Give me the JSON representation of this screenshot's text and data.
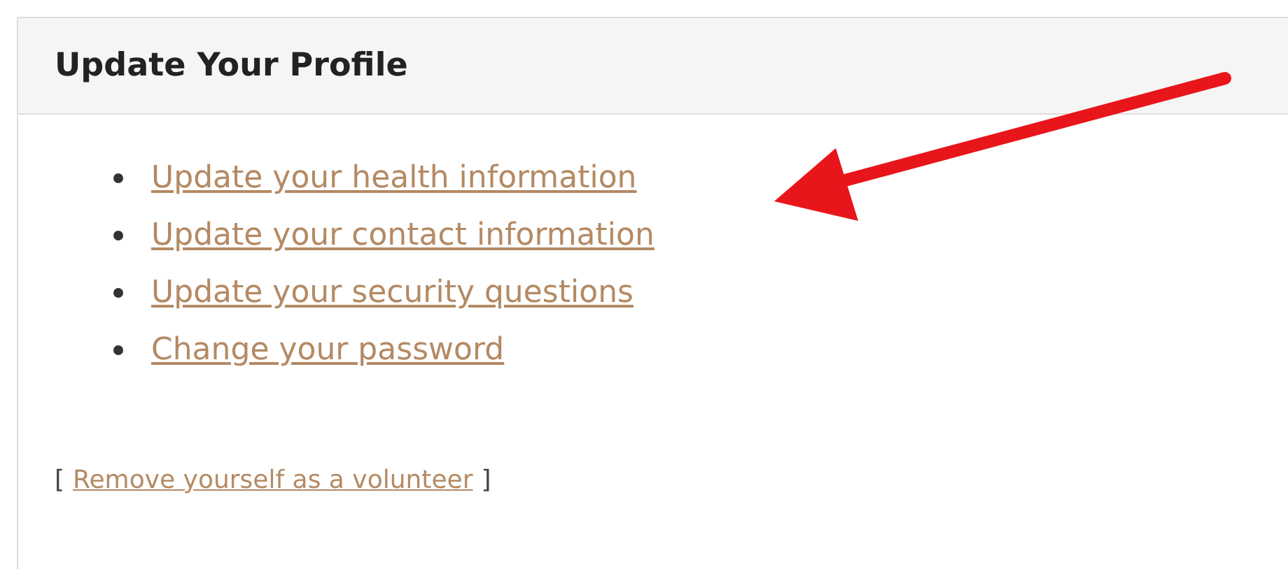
{
  "panel": {
    "title": "Update Your Profile",
    "links": [
      {
        "label": "Update your health information"
      },
      {
        "label": "Update your contact information"
      },
      {
        "label": "Update your security questions"
      },
      {
        "label": "Change your password"
      }
    ],
    "footer": {
      "open_bracket": "[",
      "link": "Remove yourself as a volunteer",
      "close_bracket": "]"
    }
  }
}
